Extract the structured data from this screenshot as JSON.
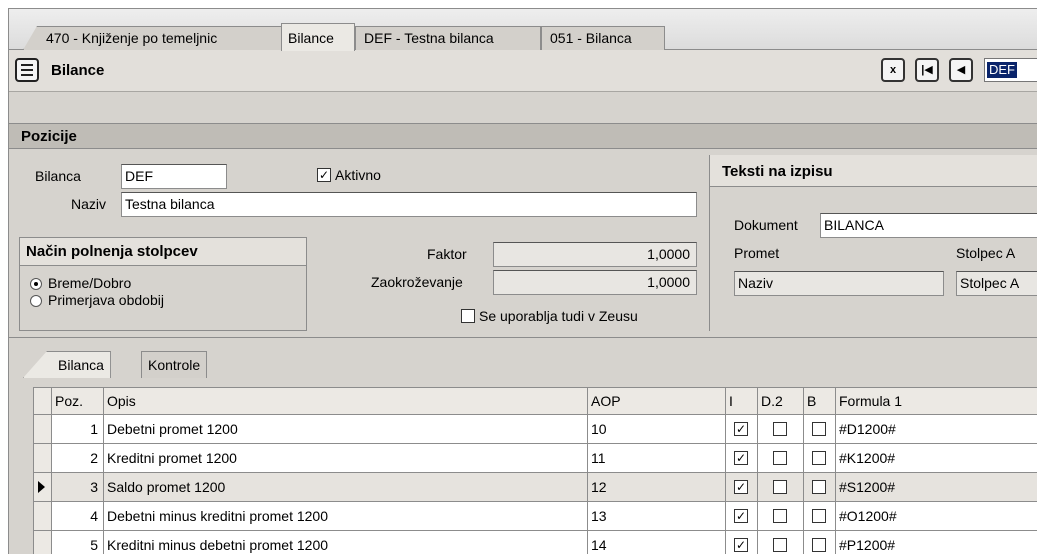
{
  "doc_tabs": [
    {
      "label": "470 - Knjiženje po temeljnic"
    },
    {
      "label": "Bilance"
    },
    {
      "label": "DEF - Testna bilanca"
    },
    {
      "label": "051 - Bilanca"
    }
  ],
  "header": {
    "title": "Bilance",
    "record_value": "DEF",
    "nav_first": "|◀",
    "nav_prev": "◀",
    "export_icon": "x"
  },
  "section": {
    "title": "Pozicije"
  },
  "form": {
    "bilanca_label": "Bilanca",
    "bilanca_value": "DEF",
    "aktivno_label": "Aktivno",
    "aktivno_checked": "✓",
    "naziv_label": "Naziv",
    "naziv_value": "Testna bilanca",
    "fill_group_title": "Način polnenja stolpcev",
    "fill_options": [
      "Breme/Dobro",
      "Primerjava obdobij"
    ],
    "faktor_label": "Faktor",
    "faktor_value": "1,0000",
    "zaokrozevanje_label": "Zaokroževanje",
    "zaokrozevanje_value": "1,0000",
    "zeus_label": "Se uporablja tudi v Zeusu",
    "print_title": "Teksti na izpisu",
    "dokument_label": "Dokument",
    "dokument_value": "BILANCA",
    "promet_label": "Promet",
    "promet_value": "Naziv",
    "stolpec_label": "Stolpec A",
    "stolpec_value": "Stolpec A"
  },
  "inner_tabs": [
    {
      "label": "Bilanca"
    },
    {
      "label": "Kontrole"
    }
  ],
  "grid": {
    "columns": [
      "Poz.",
      "Opis",
      "AOP",
      "I",
      "D.2",
      "B",
      "Formula 1"
    ],
    "rows": [
      {
        "poz": "1",
        "opis": "Debetni promet 1200",
        "aop": "10",
        "i": "✓",
        "formula": "#D1200#"
      },
      {
        "poz": "2",
        "opis": "Kreditni promet 1200",
        "aop": "11",
        "i": "✓",
        "formula": "#K1200#"
      },
      {
        "poz": "3",
        "opis": "Saldo promet 1200",
        "aop": "12",
        "i": "✓",
        "formula": "#S1200#"
      },
      {
        "poz": "4",
        "opis": "Debetni minus kreditni promet 1200",
        "aop": "13",
        "i": "✓",
        "formula": "#O1200#"
      },
      {
        "poz": "5",
        "opis": "Kreditni minus debetni promet 1200",
        "aop": "14",
        "i": "✓",
        "formula": "#P1200#"
      }
    ]
  }
}
